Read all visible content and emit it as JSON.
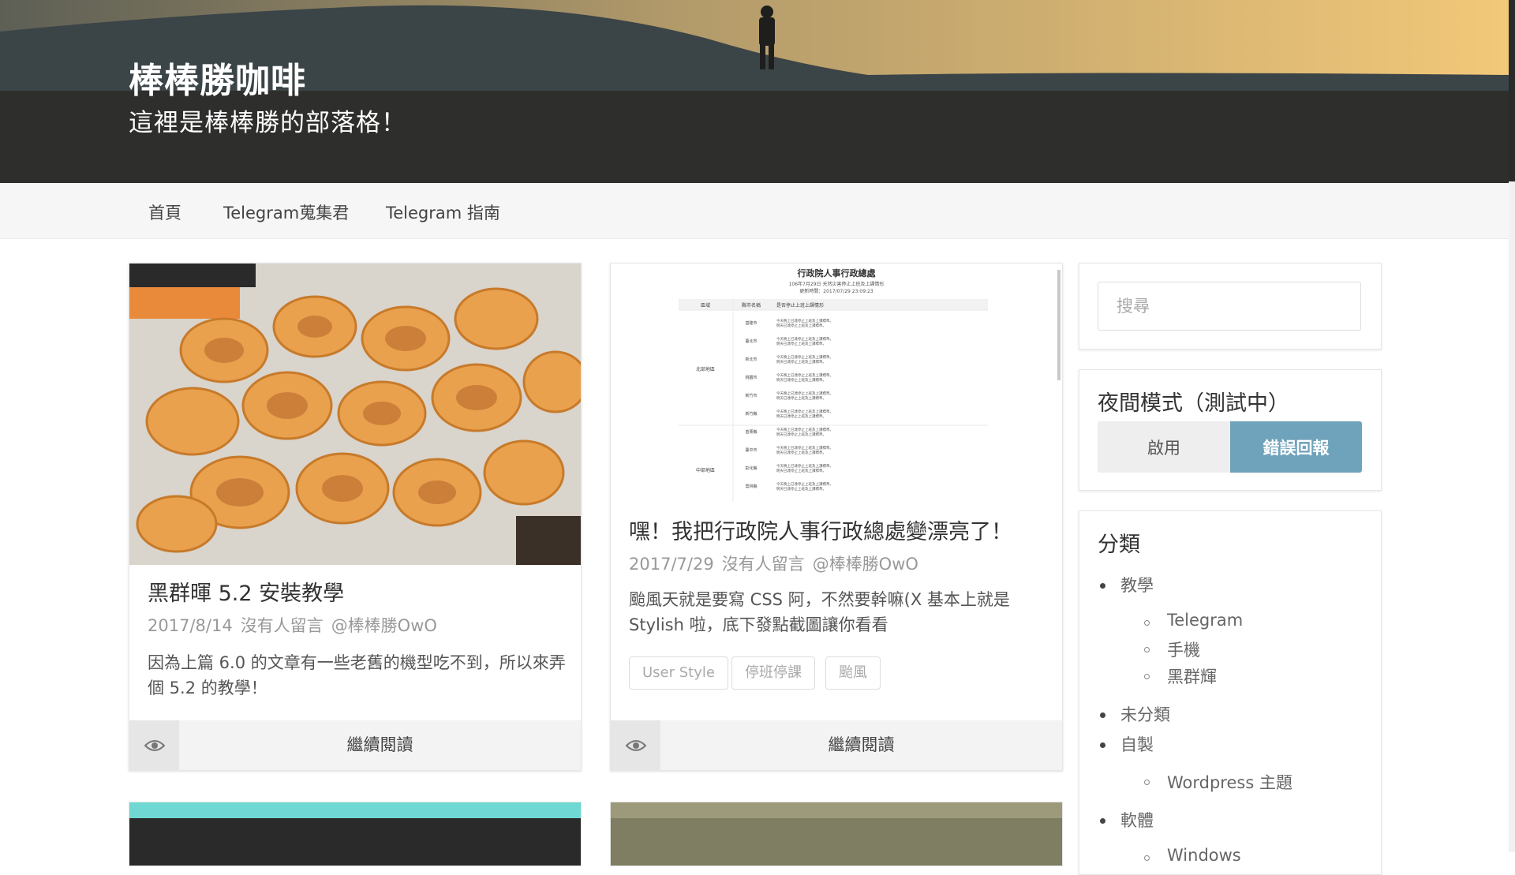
{
  "site": {
    "title": "棒棒勝咖啡",
    "description": "這裡是棒棒勝的部落格！"
  },
  "nav": {
    "items": [
      {
        "label": "首頁"
      },
      {
        "label": "Telegram蒐集君"
      },
      {
        "label": "Telegram 指南"
      }
    ]
  },
  "posts": [
    {
      "title": "黑群暉 5.2 安裝教學",
      "date": "2017/8/14",
      "comments": "沒有人留言",
      "author": "@棒棒勝OwO",
      "excerpt": "因為上篇 6.0 的文章有一些老舊的機型吃不到，所以來弄個 5.2 的教學！",
      "read_more": "繼續閱讀",
      "tags": []
    },
    {
      "title": "嘿！我把行政院人事行政總處變漂亮了！",
      "date": "2017/7/29",
      "comments": "沒有人留言",
      "author": "@棒棒勝OwO",
      "excerpt": "颱風天就是要寫 CSS 阿，不然要幹嘛(X 基本上就是 Stylish 啦，底下發點截圖讓你看看",
      "read_more": "繼續閱讀",
      "tags": [
        "User Style",
        "停班停課",
        "颱風"
      ],
      "thumbnail": {
        "heading": "行政院人事行政總處",
        "subheading": "106年7月29日 天然災害停止上班及上課情形",
        "updated": "更新時間：2017/07/29 23:09:23",
        "col_region": "區域",
        "col_city": "縣市名稱",
        "col_status": "是否停止上班上課情形",
        "regions": [
          "北部地區",
          "中部地區"
        ],
        "cities": [
          "基隆市",
          "臺北市",
          "新北市",
          "桃園市",
          "新竹市",
          "新竹縣",
          "苗栗縣",
          "臺中市",
          "彰化縣",
          "雲林縣"
        ],
        "status_line1": "今天晚上已達停止上班及上課標準。",
        "status_line2": "明天已達停止上班及上課標準。"
      }
    }
  ],
  "sidebar": {
    "search": {
      "placeholder": "搜尋"
    },
    "night_mode": {
      "title": "夜間模式（測試中）",
      "enable_label": "啟用",
      "report_label": "錯誤回報",
      "report_color": "#6fa3bb"
    },
    "categories": {
      "title": "分類",
      "items": [
        {
          "label": "教學",
          "children": [
            "Telegram",
            "手機",
            "黑群輝"
          ]
        },
        {
          "label": "未分類",
          "children": []
        },
        {
          "label": "自製",
          "children": [
            "Wordpress 主題"
          ]
        },
        {
          "label": "軟體",
          "children": [
            "Windows"
          ]
        }
      ]
    }
  },
  "icons": {
    "read_icon": "eye-icon"
  }
}
